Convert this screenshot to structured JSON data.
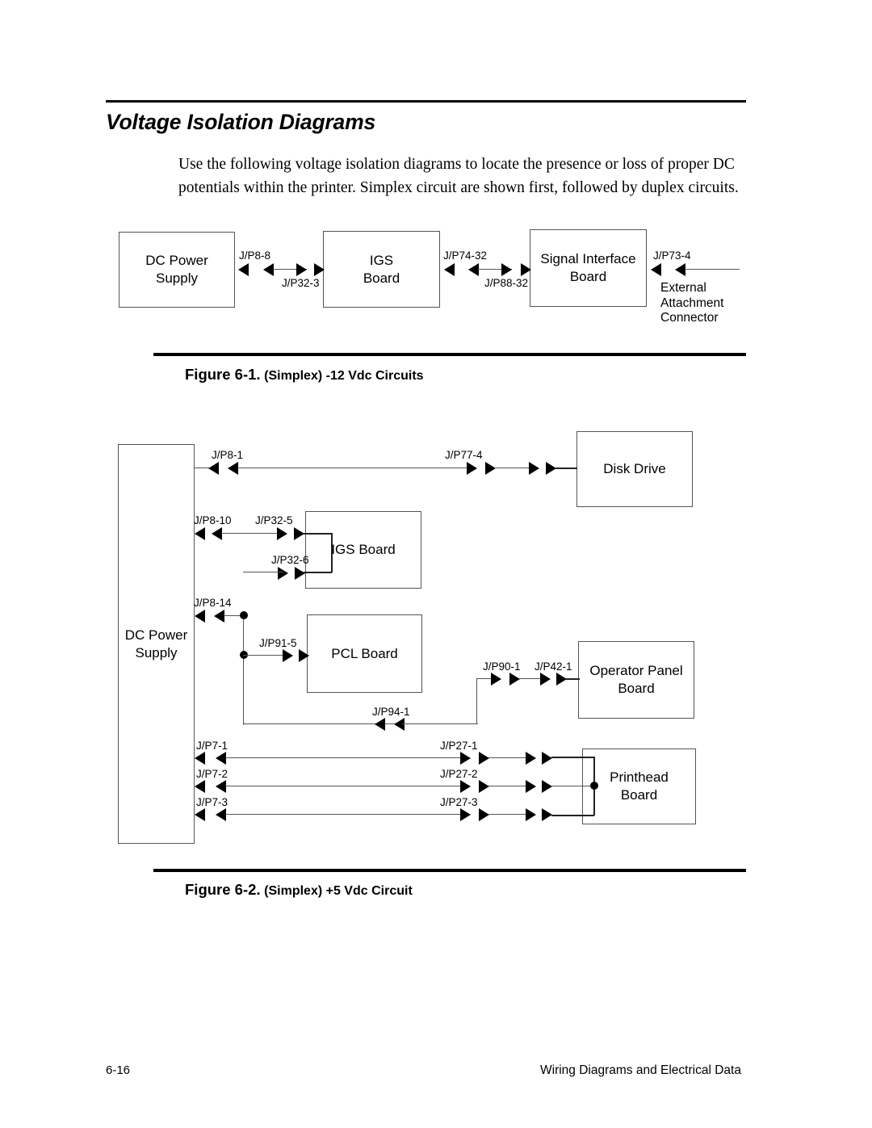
{
  "document": {
    "title": "Voltage Isolation Diagrams",
    "intro": "Use the following voltage isolation diagrams to locate the presence or loss of proper DC potentials within the printer. Simplex circuit are shown first, followed by duplex circuits.",
    "footer": {
      "page_number": "6-16",
      "section": "Wiring Diagrams and Electrical Data"
    }
  },
  "figure1": {
    "caption_number": "Figure 6-1.",
    "caption_text": "(Simplex) -12 Vdc Circuits",
    "blocks": {
      "dc_power_supply": "DC Power\nSupply",
      "dc_power_supply_line1": "DC Power",
      "dc_power_supply_line2": "Supply",
      "igs_board_line1": "IGS",
      "igs_board_line2": "Board",
      "signal_interface_line1": "Signal Interface",
      "signal_interface_line2": "Board"
    },
    "labels": {
      "p8_8": "J/P8-8",
      "p32_3": "J/P32-3",
      "p74_32": "J/P74-32",
      "p88_32": "J/P88-32",
      "p73_4": "J/P73-4",
      "external_line1": "External",
      "external_line2": "Attachment",
      "external_line3": "Connector"
    }
  },
  "figure2": {
    "caption_number": "Figure 6-2.",
    "caption_text": "(Simplex) +5 Vdc Circuit",
    "blocks": {
      "dc_power_supply_line1": "DC Power",
      "dc_power_supply_line2": "Supply",
      "disk_drive": "Disk Drive",
      "igs_board": "IGS Board",
      "pcl_board": "PCL Board",
      "operator_panel_line1": "Operator Panel",
      "operator_panel_line2": "Board",
      "printhead_line1": "Printhead",
      "printhead_line2": "Board"
    },
    "labels": {
      "p8_1": "J/P8-1",
      "p77_4": "J/P77-4",
      "p8_10": "J/P8-10",
      "p32_5": "J/P32-5",
      "p32_6": "J/P32-6",
      "p8_14": "J/P8-14",
      "p91_5": "J/P91-5",
      "p90_1": "J/P90-1",
      "p42_1": "J/P42-1",
      "p94_1": "J/P94-1",
      "p7_1": "J/P7-1",
      "p7_2": "J/P7-2",
      "p7_3": "J/P7-3",
      "p27_1": "J/P27-1",
      "p27_2": "J/P27-2",
      "p27_3": "J/P27-3"
    }
  }
}
